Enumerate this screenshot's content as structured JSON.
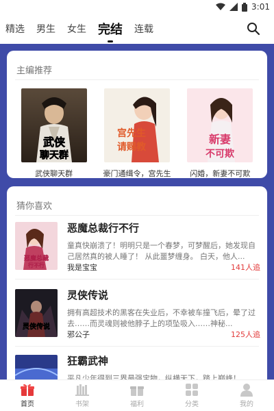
{
  "status_bar": {
    "time": "3:01",
    "icons": [
      "wifi-icon",
      "signal-icon",
      "battery-icon"
    ]
  },
  "tabs": [
    {
      "label": "精选",
      "active": false
    },
    {
      "label": "男生",
      "active": false
    },
    {
      "label": "女生",
      "active": false
    },
    {
      "label": "完结",
      "active": true
    },
    {
      "label": "连载",
      "active": false
    }
  ],
  "search_icon": "search-icon",
  "editor_picks": {
    "title": "主编推荐",
    "books": [
      {
        "title": "武侠聊天群",
        "cover_text": "武侠聊天群"
      },
      {
        "title": "豪门通缉令，宫先生",
        "cover_text": "宫先生请赐教"
      },
      {
        "title": "闪婚，新妻不可欺",
        "cover_text": "新妻不可欺"
      }
    ]
  },
  "guess_you_like": {
    "title": "猜你喜欢",
    "items": [
      {
        "title": "恶魔总裁行不行",
        "desc": "童真快崩溃了！明明只是一个春梦，可梦醒后，她发现自己居然真的被人睡了！ 从此噩梦缠身。 白天，他人...",
        "author": "我是宝宝",
        "count": "141人追",
        "cover_text": "恶魔总裁行不行"
      },
      {
        "title": "灵侠传说",
        "desc": "拥有高超技术的黑客在失业后，不幸被车撞飞后，晕了过去……而灵魂则被他脖子上的项坠吸入……神秘...",
        "author": "邪公子",
        "count": "125人追",
        "cover_text": "灵侠传说"
      },
      {
        "title": "狂霸武神",
        "desc": "平凡少年得到三界最强宝物，纵横天下，踏上巅峰！",
        "author": "",
        "count": "",
        "cover_text": ""
      }
    ]
  },
  "bottom_nav": [
    {
      "label": "首页",
      "icon": "gift-icon",
      "active": true
    },
    {
      "label": "书架",
      "icon": "bookshelf-icon",
      "active": false
    },
    {
      "label": "福利",
      "icon": "gift-box-icon",
      "active": false
    },
    {
      "label": "分类",
      "icon": "grid-icon",
      "active": false
    },
    {
      "label": "我的",
      "icon": "user-icon",
      "active": false
    }
  ],
  "colors": {
    "background": "#3f4ba8",
    "accent_red": "#e23a3a",
    "card": "#ffffff"
  }
}
